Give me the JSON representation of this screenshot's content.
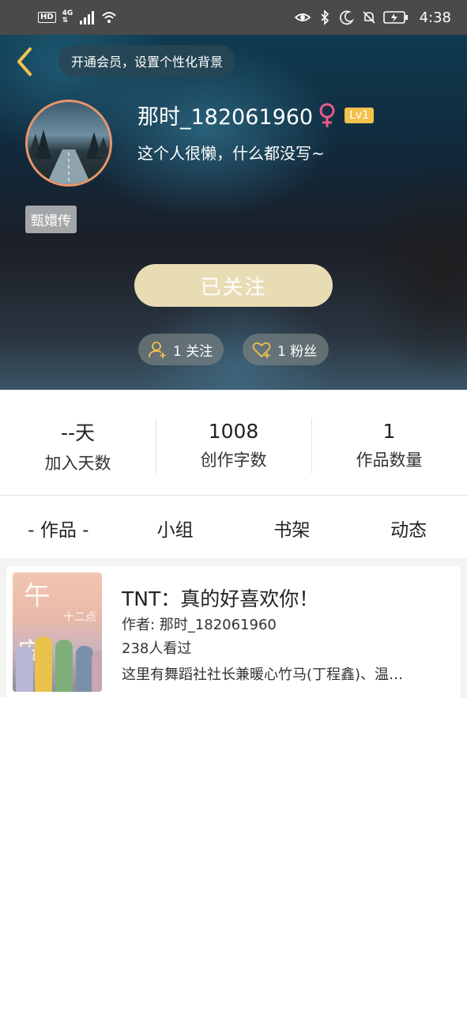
{
  "status_bar": {
    "hd": "HD",
    "network_top": "4G",
    "network_bottom": "⇅",
    "time": "4:38"
  },
  "header": {
    "vip_prompt": "开通会员，设置个性化背景",
    "username": "那时_182061960",
    "level": "Lv1",
    "bio": "这个人很懒，什么都没写~",
    "tag": "甄嬛传",
    "follow_button": "已关注",
    "following_count": "1 关注",
    "fans_count": "1 粉丝"
  },
  "stats": [
    {
      "value": "--天",
      "label": "加入天数"
    },
    {
      "value": "1008",
      "label": "创作字数"
    },
    {
      "value": "1",
      "label": "作品数量"
    }
  ],
  "tabs": [
    {
      "label": "- 作品 -"
    },
    {
      "label": "小组"
    },
    {
      "label": "书架"
    },
    {
      "label": "动态"
    }
  ],
  "works": [
    {
      "title": "TNT：真的好喜欢你！",
      "author": "作者: 那时_182061960",
      "views": "238人看过",
      "description": "这里有舞蹈社社长兼暖心竹马(丁程鑫)、温…",
      "cover_text_1": "午",
      "cover_text_2": "安",
      "cover_small_text": "十二点"
    }
  ],
  "colors": {
    "accent_gold": "#f2c14e",
    "follow_button_bg": "#e8dcb5",
    "avatar_border": "#e8956a"
  }
}
